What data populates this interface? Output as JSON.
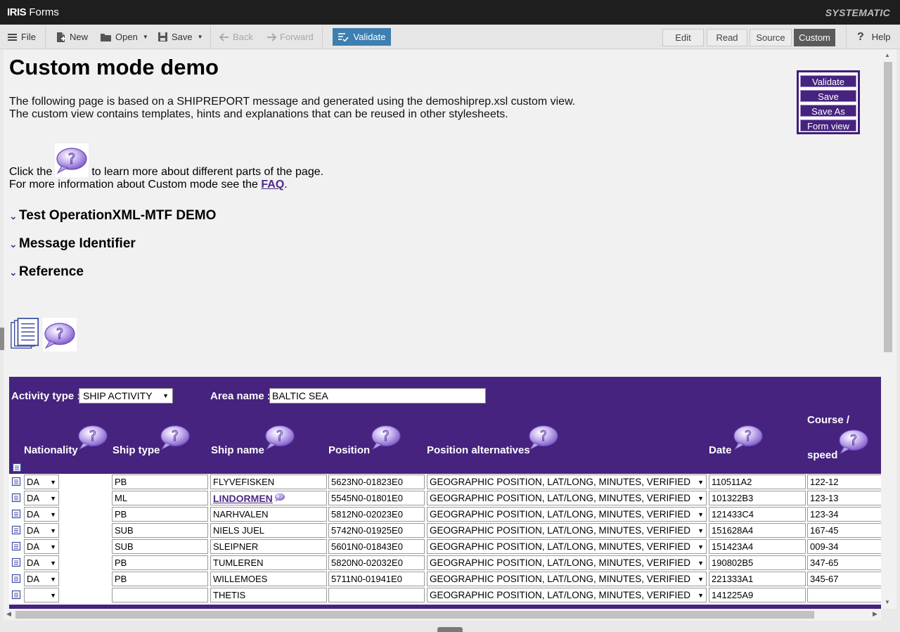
{
  "titlebar": {
    "app_bold": "IRIS",
    "app_rest": " Forms",
    "brand": "SYSTEMATIC"
  },
  "toolbar": {
    "file": "File",
    "new": "New",
    "open": "Open",
    "save": "Save",
    "back": "Back",
    "forward": "Forward",
    "validate": "Validate",
    "modes": [
      "Edit",
      "Read",
      "Source",
      "Custom"
    ],
    "active_mode": "Custom",
    "help": "Help"
  },
  "page": {
    "title": "Custom mode demo",
    "intro_line1": "The following page is based on a SHIPREPORT message and generated using the demoshiprep.xsl custom view.",
    "intro_line2": "The custom view contains templates, hints and explanations that can be reused in other stylesheets.",
    "click_pre": "Click the",
    "click_post": "to learn more about different parts of the page.",
    "info_pre": "For more information about Custom mode see the",
    "faq": "FAQ",
    "info_post": "."
  },
  "side_panel": {
    "buttons": [
      "Validate",
      "Save",
      "Save As",
      "Form view"
    ]
  },
  "sections": [
    "Test OperationXML-MTF DEMO",
    "Message Identifier",
    "Reference"
  ],
  "form": {
    "activity_label": "Activity type :",
    "activity_value": "SHIP ACTIVITY",
    "area_label": "Area name :",
    "area_value": "BALTIC SEA",
    "columns": {
      "nationality": "Nationality",
      "ship_type": "Ship type",
      "ship_name": "Ship name",
      "position": "Position",
      "position_alt": "Position alternatives",
      "date": "Date",
      "course_1": "Course /",
      "course_2": "speed"
    },
    "rows": [
      {
        "nat": "DA",
        "type": "PB",
        "name": "FLYVEFISKEN",
        "pos": "5623N0-01823E0",
        "alt": "GEOGRAPHIC POSITION, LAT/LONG, MINUTES, VERIFIED",
        "date": "110511A2",
        "course": "122-12"
      },
      {
        "nat": "DA",
        "type": "ML",
        "name": "LINDORMEN",
        "pos": "5545N0-01801E0",
        "alt": "GEOGRAPHIC POSITION, LAT/LONG, MINUTES, VERIFIED",
        "date": "101322B3",
        "course": "123-13"
      },
      {
        "nat": "DA",
        "type": "PB",
        "name": "NARHVALEN",
        "pos": "5812N0-02023E0",
        "alt": "GEOGRAPHIC POSITION, LAT/LONG, MINUTES, VERIFIED",
        "date": "121433C4",
        "course": "123-34"
      },
      {
        "nat": "DA",
        "type": "SUB",
        "name": "NIELS JUEL",
        "pos": "5742N0-01925E0",
        "alt": "GEOGRAPHIC POSITION, LAT/LONG, MINUTES, VERIFIED",
        "date": "151628A4",
        "course": "167-45"
      },
      {
        "nat": "DA",
        "type": "SUB",
        "name": "SLEIPNER",
        "pos": "5601N0-01843E0",
        "alt": "GEOGRAPHIC POSITION, LAT/LONG, MINUTES, VERIFIED",
        "date": "151423A4",
        "course": "009-34"
      },
      {
        "nat": "DA",
        "type": "PB",
        "name": "TUMLEREN",
        "pos": "5820N0-02032E0",
        "alt": "GEOGRAPHIC POSITION, LAT/LONG, MINUTES, VERIFIED",
        "date": "190802B5",
        "course": "347-65"
      },
      {
        "nat": "DA",
        "type": "PB",
        "name": "WILLEMOES",
        "pos": "5711N0-01941E0",
        "alt": "GEOGRAPHIC POSITION, LAT/LONG, MINUTES, VERIFIED",
        "date": "221333A1",
        "course": "345-67"
      },
      {
        "nat": "",
        "type": "",
        "name": "THETIS",
        "pos": "",
        "alt": "GEOGRAPHIC POSITION, LAT/LONG, MINUTES, VERIFIED",
        "date": "141225A9",
        "course": ""
      }
    ]
  },
  "colors": {
    "accent_purple": "#45237e",
    "validate_blue": "#3c7fb0",
    "link": "#4b2a85"
  },
  "icons": [
    "menu-icon",
    "new-doc-icon",
    "folder-icon",
    "save-disk-icon",
    "arrow-left-icon",
    "arrow-right-icon",
    "validate-check-icon",
    "help-icon",
    "help-bubble-icon",
    "document-stack-icon",
    "chevron-down-icon"
  ]
}
